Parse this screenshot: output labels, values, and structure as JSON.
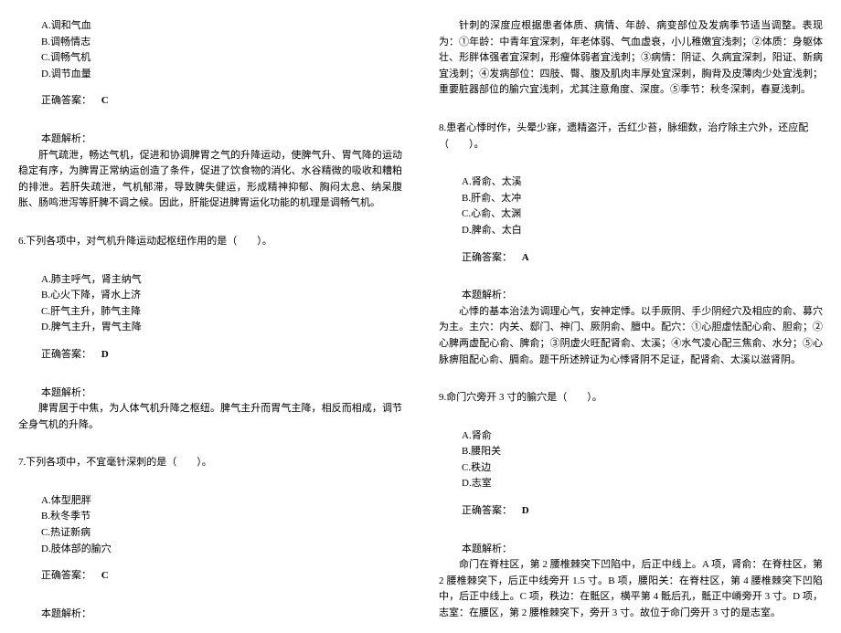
{
  "left": {
    "q5": {
      "options": {
        "a": "A.调和气血",
        "b": "B.调畅情志",
        "c": "C.调畅气机",
        "d": "D.调节血量"
      },
      "answerLabel": "正确答案：",
      "answer": "C",
      "analysisLabel": "本题解析：",
      "analysis": "肝气疏泄，畅达气机，促进和协调脾胃之气的升降运动，使脾气升、胃气降的运动稳定有序，为脾胃正常纳运创造了条件，促进了饮食物的消化、水谷精微的吸收和糟粕的排泄。若肝失疏泄，气机郁滞，导致脾失健运，形成精神抑郁、胸闷太息、纳呆腹胀、肠鸣泄泻等肝脾不调之候。因此，肝能促进脾胃运化功能的机理是调畅气机。"
    },
    "q6": {
      "stem": "6.下列各项中，对气机升降运动起枢纽作用的是（　　）。",
      "options": {
        "a": "A.肺主呼气，肾主纳气",
        "b": "B.心火下降，肾水上济",
        "c": "C.肝气主升，肺气主降",
        "d": "D.脾气主升，胃气主降"
      },
      "answerLabel": "正确答案：",
      "answer": "D",
      "analysisLabel": "本题解析：",
      "analysis": "脾胃居于中焦，为人体气机升降之枢纽。脾气主升而胃气主降，相反而相成，调节全身气机的升降。"
    },
    "q7": {
      "stem": "7.下列各项中，不宜毫针深刺的是（　　）。",
      "options": {
        "a": "A.体型肥胖",
        "b": "B.秋冬季节",
        "c": "C.热证新病",
        "d": "D.肢体部的腧穴"
      },
      "answerLabel": "正确答案：",
      "answer": "C",
      "analysisLabel": "本题解析："
    }
  },
  "right": {
    "q7analysis": "针刺的深度应根据患者体质、病情、年龄、病变部位及发病季节适当调整。表现为：①年龄：中青年宜深刺，年老体弱、气血虚衰，小儿稚嫩宜浅刺；②体质：身躯体壮、形胖体强者宜深刺，形瘦体弱者宜浅刺；③病情：阴证、久病宜深刺，阳证、新病宜浅刺；④发病部位：四肢、臀、腹及肌肉丰厚处宜深刺，胸背及皮薄肉少处宜浅刺；重要脏器部位的腧穴宜浅刺，尤其注意角度、深度。⑤季节：秋冬深刺，春夏浅刺。",
    "q8": {
      "stem": "8.患者心悸时作，头晕少寐，遗精盗汗，舌红少苔，脉细数，治疗除主穴外，还应配（　　）。",
      "options": {
        "a": "A.肾俞、太溪",
        "b": "B.肝俞、太冲",
        "c": "C.心俞、太渊",
        "d": "D.脾俞、太白"
      },
      "answerLabel": "正确答案：",
      "answer": "A",
      "analysisLabel": "本题解析：",
      "analysis": "心悸的基本治法为调理心气，安神定悸。以手厥阴、手少阴经穴及相应的俞、募穴为主。主穴：内关、郄门、神门、厥阴俞、膻中。配穴：①心胆虚怯配心俞、胆俞；②心脾两虚配心俞、脾俞；③阴虚火旺配肾俞、太溪；④水气凌心配三焦俞、水分；⑤心脉痹阻配心俞、膈俞。题干所述辨证为心悸肾阴不足证，配肾俞、太溪以滋肾阴。"
    },
    "q9": {
      "stem": "9.命门穴旁开 3 寸的腧穴是（　　）。",
      "options": {
        "a": "A.肾俞",
        "b": "B.腰阳关",
        "c": "C.秩边",
        "d": "D.志室"
      },
      "answerLabel": "正确答案：",
      "answer": "D",
      "analysisLabel": "本题解析：",
      "analysis": "命门在脊柱区，第 2 腰椎棘突下凹陷中，后正中线上。A 项，肾俞：在脊柱区，第 2 腰椎棘突下，后正中线旁开 1.5 寸。B 项，腰阳关：在脊柱区，第 4 腰椎棘突下凹陷中，后正中线上。C 项，秩边：在骶区，横平第 4 骶后孔，骶正中嵴旁开 3 寸。D 项，志室：在腰区，第 2 腰椎棘突下，旁开 3 寸。故位于命门旁开 3 寸的是志室。"
    }
  }
}
